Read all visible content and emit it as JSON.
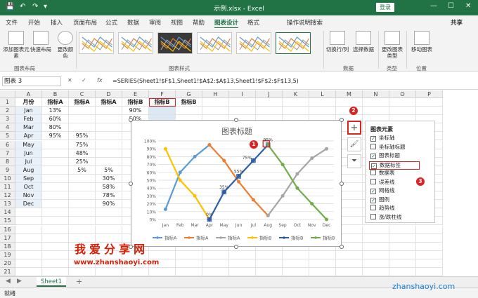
{
  "window": {
    "title": "示例.xlsx  -  Excel",
    "login": "登录",
    "min": "—",
    "max": "☐",
    "close": "✕",
    "qa_save": "💾",
    "qa_undo": "↶",
    "qa_redo": "↷",
    "qa_more": "▾"
  },
  "tabs": [
    "文件",
    "开始",
    "插入",
    "页面布局",
    "公式",
    "数据",
    "审阅",
    "视图",
    "帮助",
    "图表设计",
    "格式",
    "操作说明搜索"
  ],
  "active_tab": "图表设计",
  "share": "共享",
  "ribbon": {
    "add_element": "添加图表元素",
    "quick_layout": "快速布局",
    "change_color": "更改颜色",
    "switch_rowcol": "切换行/列",
    "select_data": "选择数据",
    "change_type": "更改图表类型",
    "move_chart": "移动图表",
    "grp_layout": "图表布局",
    "grp_style": "图表样式",
    "grp_data": "数据",
    "grp_type": "类型",
    "grp_location": "位置"
  },
  "namebox": "图表 3",
  "formula_icons": {
    "cancel": "✕",
    "enter": "✓",
    "fx": "fx"
  },
  "formula": "=SERIES(Sheet1!$F$1,Sheet1!$A$2:$A$13,Sheet1!$F$2:$F$13,5)",
  "columns": [
    "A",
    "B",
    "C",
    "D",
    "E",
    "F",
    "G",
    "H",
    "I",
    "J",
    "K",
    "L",
    "M",
    "N",
    "O",
    "P"
  ],
  "rows": [
    "1",
    "2",
    "3",
    "4",
    "5",
    "6",
    "7",
    "8",
    "9",
    "10",
    "11",
    "12",
    "13",
    "14",
    "15",
    "16",
    "17",
    "18",
    "19",
    "20",
    "21",
    "22"
  ],
  "headers": {
    "A": "月份",
    "B": "指标A",
    "C": "指标A",
    "D": "指标A",
    "E": "指标B",
    "F": "指标B",
    "G": "指标B"
  },
  "months": [
    "Jan",
    "Feb",
    "Mar",
    "Apr",
    "May",
    "Jun",
    "Jul",
    "Aug",
    "Sep",
    "Oct",
    "Nov",
    "Dec"
  ],
  "colB": [
    "13%",
    "60%",
    "80%",
    "95%",
    "",
    "",
    "",
    "",
    "",
    "",
    "",
    ""
  ],
  "colC": [
    "",
    "",
    "",
    "95%",
    "75%",
    "48%",
    "25%",
    "5%",
    "",
    "",
    "",
    ""
  ],
  "colD": [
    "",
    "",
    "",
    "",
    "",
    "",
    "",
    "5%",
    "30%",
    "58%",
    "78%",
    "90%"
  ],
  "colE": [
    "90%",
    "50%",
    "",
    "",
    "",
    "",
    "",
    "",
    "",
    "",
    "",
    ""
  ],
  "chart_data": {
    "type": "line",
    "title": "图表标题",
    "categories": [
      "Jan",
      "Feb",
      "Mar",
      "Apr",
      "May",
      "Jun",
      "Jul",
      "Aug",
      "Sep",
      "Oct",
      "Nov",
      "Dec"
    ],
    "ylim": [
      0,
      1
    ],
    "yticks": [
      "0%",
      "10%",
      "20%",
      "30%",
      "40%",
      "50%",
      "60%",
      "70%",
      "80%",
      "90%",
      "100%"
    ],
    "grid": true,
    "legend_position": "bottom",
    "series": [
      {
        "name": "指标A",
        "color": "#5b9bd5",
        "values": [
          0.13,
          0.6,
          0.8,
          0.95,
          null,
          null,
          null,
          null,
          null,
          null,
          null,
          null
        ]
      },
      {
        "name": "指标A",
        "color": "#ed7d31",
        "values": [
          null,
          null,
          null,
          0.95,
          0.75,
          0.48,
          0.25,
          0.05,
          null,
          null,
          null,
          null
        ]
      },
      {
        "name": "指标A",
        "color": "#a5a5a5",
        "values": [
          null,
          null,
          null,
          null,
          null,
          null,
          null,
          0.05,
          0.3,
          0.58,
          0.78,
          0.9
        ]
      },
      {
        "name": "指标B",
        "color": "#ffc000",
        "values": [
          0.9,
          0.5,
          0.3,
          0.0,
          null,
          null,
          null,
          null,
          null,
          null,
          null,
          null
        ]
      },
      {
        "name": "指标B",
        "color": "#2e5fa8",
        "values": [
          null,
          null,
          null,
          0.0,
          0.35,
          0.55,
          0.75,
          0.95,
          null,
          null,
          null,
          null
        ]
      },
      {
        "name": "指标B",
        "color": "#70ad47",
        "values": [
          null,
          null,
          null,
          null,
          null,
          null,
          null,
          0.95,
          0.7,
          0.4,
          0.2,
          0.0
        ]
      }
    ],
    "data_labels": [
      {
        "series": 4,
        "index": 3,
        "text": "0%"
      },
      {
        "series": 4,
        "index": 4,
        "text": "35%"
      },
      {
        "series": 4,
        "index": 5,
        "text": "55%"
      },
      {
        "series": 4,
        "index": 6,
        "text": "75%"
      },
      {
        "series": 4,
        "index": 7,
        "text": "95%"
      }
    ]
  },
  "chart_elements": {
    "title": "图表元素",
    "items": [
      {
        "label": "坐标轴",
        "checked": true
      },
      {
        "label": "坐标轴标题",
        "checked": false
      },
      {
        "label": "图表标题",
        "checked": true
      },
      {
        "label": "数据标签",
        "checked": true
      },
      {
        "label": "数据表",
        "checked": false
      },
      {
        "label": "误差线",
        "checked": false
      },
      {
        "label": "网格线",
        "checked": true
      },
      {
        "label": "图例",
        "checked": true
      },
      {
        "label": "趋势线",
        "checked": false
      },
      {
        "label": "涨/跌柱线",
        "checked": false
      }
    ]
  },
  "side_buttons": {
    "plus": "+",
    "brush": "🖌",
    "filter": "⏷"
  },
  "badges": [
    "1",
    "2",
    "3"
  ],
  "sheet_tab": "Sheet1",
  "add_sheet": "+",
  "status": "就绪",
  "watermark": {
    "title": "我爱分享网",
    "url": "www.zhanshaoyi.com",
    "corner": "zhanshaoyi.com"
  },
  "colors": {
    "accent": "#217346",
    "highlight": "#d22"
  }
}
